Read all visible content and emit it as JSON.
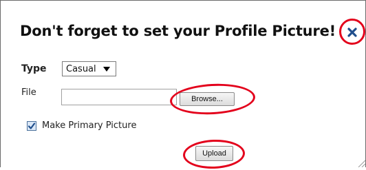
{
  "dialog": {
    "title": "Don't forget to set your Profile Picture!",
    "close_icon": "close-x-icon"
  },
  "form": {
    "type_label": "Type",
    "type_selected": "Casual",
    "file_label": "File",
    "file_value": "",
    "browse_label": "Browse...",
    "primary_checkbox_label": "Make Primary Picture",
    "primary_checked": true,
    "upload_label": "Upload"
  },
  "colors": {
    "highlight_ring": "#e3001b",
    "close_icon": "#1f4e8c",
    "checkbox_check": "#1f4e8c"
  }
}
